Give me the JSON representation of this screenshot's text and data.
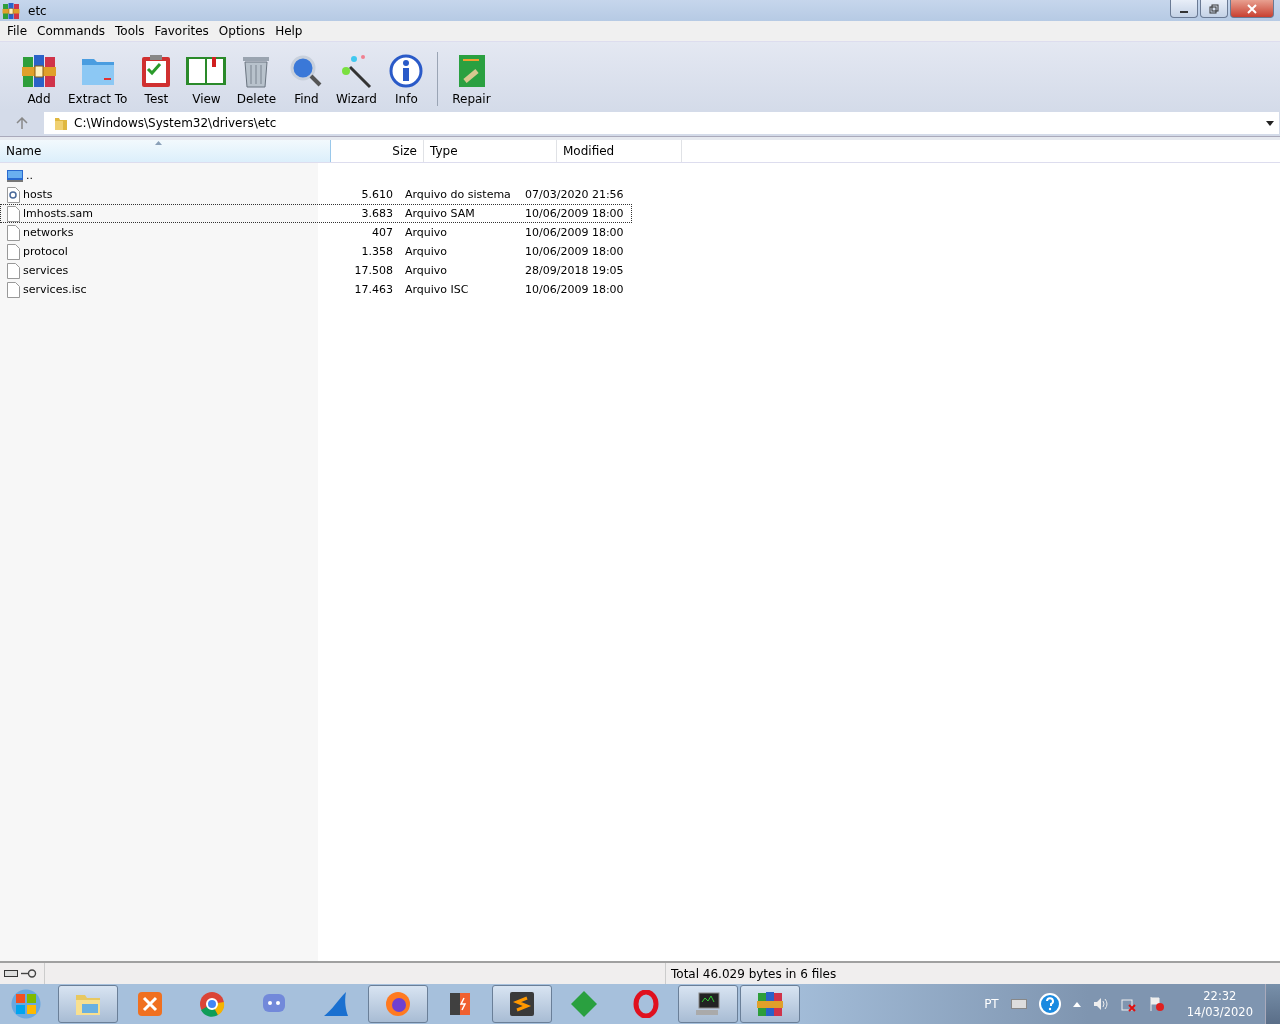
{
  "window": {
    "title": "etc"
  },
  "menu": [
    {
      "label": "File"
    },
    {
      "label": "Commands"
    },
    {
      "label": "Tools"
    },
    {
      "label": "Favorites"
    },
    {
      "label": "Options"
    },
    {
      "label": "Help"
    }
  ],
  "toolbar": [
    {
      "label": "Add"
    },
    {
      "label": "Extract To"
    },
    {
      "label": "Test"
    },
    {
      "label": "View"
    },
    {
      "label": "Delete"
    },
    {
      "label": "Find"
    },
    {
      "label": "Wizard"
    },
    {
      "label": "Info"
    },
    {
      "label": "Repair"
    }
  ],
  "address": {
    "value": "C:\\Windows\\System32\\drivers\\etc"
  },
  "table": {
    "columns": [
      {
        "label": "Name",
        "sorted": true
      },
      {
        "label": "Size",
        "sorted": false
      },
      {
        "label": "Type",
        "sorted": false
      },
      {
        "label": "Modified",
        "sorted": false
      }
    ],
    "rows": [
      {
        "kind": "parent",
        "name": "..",
        "size": "",
        "type": "",
        "modified": "",
        "focused": false
      },
      {
        "kind": "system",
        "name": "hosts",
        "size": "5.610",
        "type": "Arquivo do sistema",
        "modified": "07/03/2020 21:56",
        "focused": false
      },
      {
        "kind": "file",
        "name": "lmhosts.sam",
        "size": "3.683",
        "type": "Arquivo SAM",
        "modified": "10/06/2009 18:00",
        "focused": true
      },
      {
        "kind": "file",
        "name": "networks",
        "size": "407",
        "type": "Arquivo",
        "modified": "10/06/2009 18:00",
        "focused": false
      },
      {
        "kind": "file",
        "name": "protocol",
        "size": "1.358",
        "type": "Arquivo",
        "modified": "10/06/2009 18:00",
        "focused": false
      },
      {
        "kind": "file",
        "name": "services",
        "size": "17.508",
        "type": "Arquivo",
        "modified": "28/09/2018 19:05",
        "focused": false
      },
      {
        "kind": "file",
        "name": "services.isc",
        "size": "17.463",
        "type": "Arquivo ISC",
        "modified": "10/06/2009 18:00",
        "focused": false
      }
    ]
  },
  "status_bar": {
    "text": "Total 46.029 bytes in 6 files"
  },
  "taskbar": {
    "apps": [
      {
        "open": true
      },
      {
        "open": false
      },
      {
        "open": false
      },
      {
        "open": false
      },
      {
        "open": false
      },
      {
        "open": true
      },
      {
        "open": false
      },
      {
        "open": true
      },
      {
        "open": false
      },
      {
        "open": false
      },
      {
        "open": true
      },
      {
        "open": true
      }
    ],
    "language": "PT",
    "time": "22:32",
    "date": "14/03/2020"
  }
}
